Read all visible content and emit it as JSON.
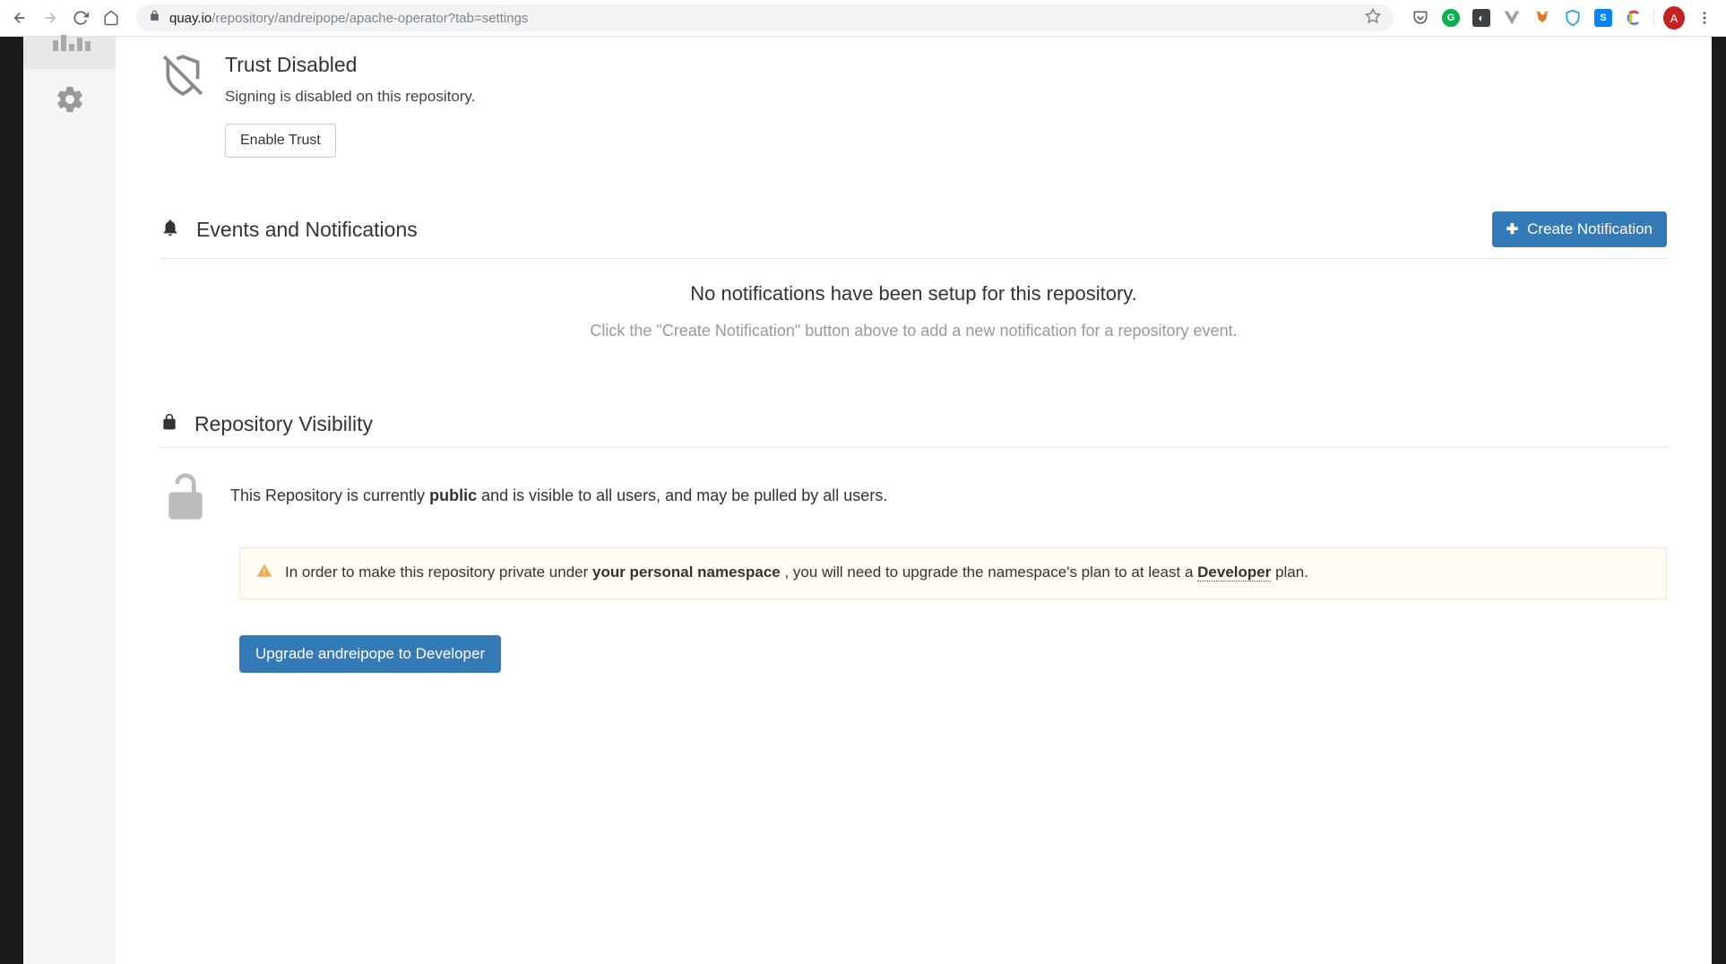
{
  "browser": {
    "url_domain": "quay.io",
    "url_path": "/repository/andreipope/apache-operator?tab=settings",
    "avatar_letter": "A"
  },
  "trust": {
    "title": "Trust Disabled",
    "description": "Signing is disabled on this repository.",
    "button": "Enable Trust"
  },
  "events": {
    "title": "Events and Notifications",
    "create_button": "Create Notification",
    "empty_message": "No notifications have been setup for this repository.",
    "empty_hint": "Click the \"Create Notification\" button above to add a new notification for a repository event."
  },
  "visibility": {
    "title": "Repository Visibility",
    "text_pre": "This Repository is currently ",
    "text_bold": "public",
    "text_post": " and is visible to all users, and may be pulled by all users.",
    "alert_pre": "In order to make this repository private under ",
    "alert_bold": "your personal namespace",
    "alert_mid": " , you will need to upgrade the namespace's plan to at least a ",
    "alert_dotted": "Developer",
    "alert_post": " plan.",
    "upgrade_button": "Upgrade andreipope to Developer"
  }
}
